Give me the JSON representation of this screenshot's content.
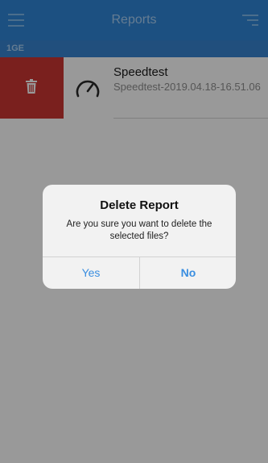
{
  "nav": {
    "title": "Reports",
    "menu_icon": "hamburger-menu-icon",
    "sort_icon": "sort-icon"
  },
  "section": {
    "label": "1GE"
  },
  "list": {
    "items": [
      {
        "title": "Speedtest",
        "subtitle": "Speedtest-2019.04.18-16.51.06",
        "icon": "speedometer-icon",
        "swipe_action_icon": "trash-icon"
      }
    ]
  },
  "dialog": {
    "title": "Delete Report",
    "message": "Are you sure you want to delete the selected files?",
    "yes_label": "Yes",
    "no_label": "No"
  },
  "colors": {
    "nav_bar": "#2f86d7",
    "section_header": "#3784d0",
    "delete_action": "#cc3632",
    "dialog_button_text": "#3a8ee0"
  }
}
